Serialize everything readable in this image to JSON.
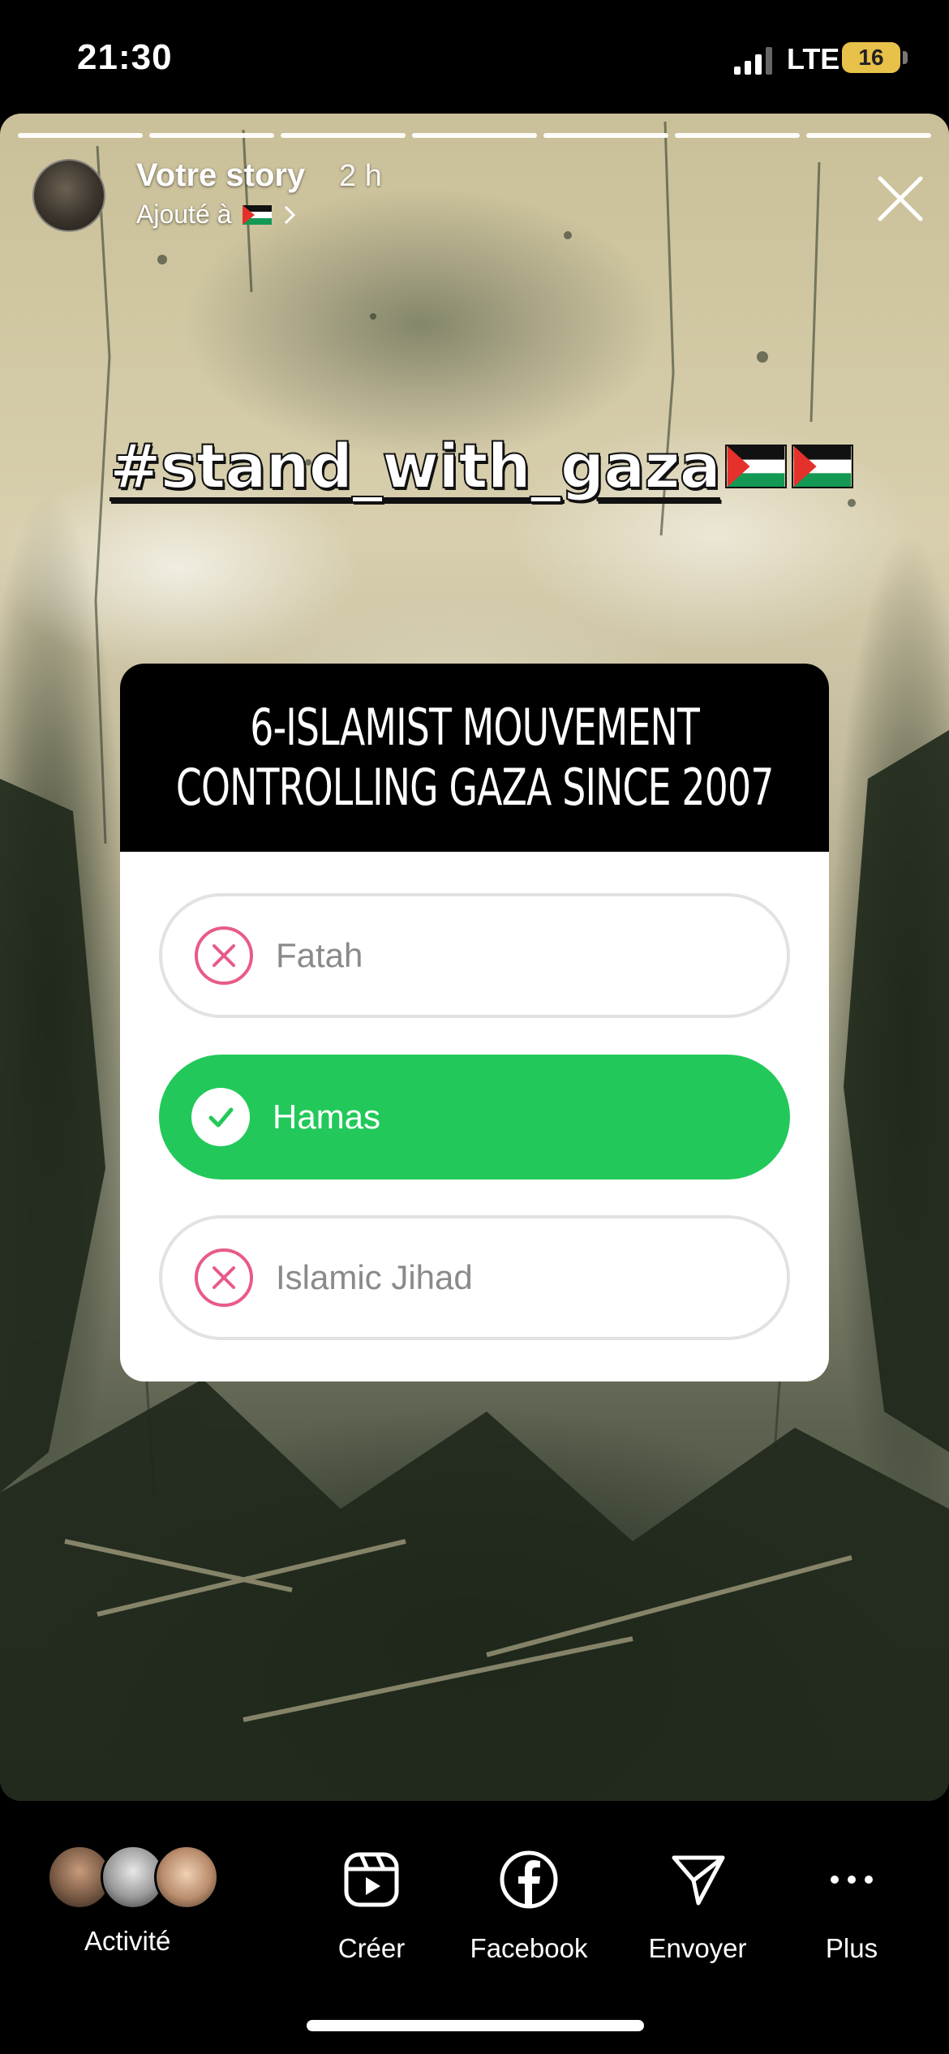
{
  "status_bar": {
    "time": "21:30",
    "network": "LTE",
    "battery": "16"
  },
  "story": {
    "title": "Votre story",
    "time_ago": "2 h",
    "added_to": "Ajouté à",
    "hashtag": "#stand_with_gaza"
  },
  "quiz": {
    "question_line1": "6-ISLAMIST MOUVEMENT",
    "question_line2": "CONTROLLING GAZA SINCE 2007",
    "options": [
      {
        "label": "Fatah",
        "state": "wrong"
      },
      {
        "label": "Hamas",
        "state": "correct"
      },
      {
        "label": "Islamic Jihad",
        "state": "wrong"
      }
    ],
    "colors": {
      "correct": "#22c95a",
      "wrong": "#e85b86"
    }
  },
  "bottom_bar": {
    "activity": "Activité",
    "create": "Créer",
    "facebook": "Facebook",
    "send": "Envoyer",
    "more": "Plus"
  },
  "icons": {
    "close": "close-icon",
    "create": "reels-icon",
    "facebook": "facebook-icon",
    "send": "paper-plane-icon",
    "more": "more-dots-icon"
  }
}
